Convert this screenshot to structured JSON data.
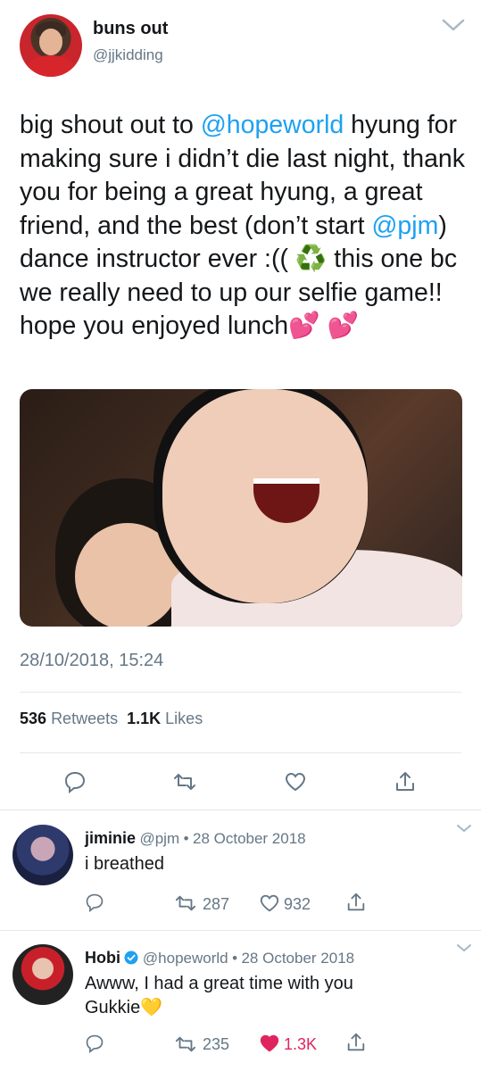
{
  "tweet": {
    "display_name": "buns out",
    "handle": "@jjkidding",
    "text_segments": [
      {
        "t": "big shout out to ",
        "link": false
      },
      {
        "t": "@hopeworld",
        "link": true
      },
      {
        "t": " hyung for making sure i didn’t die last night, thank you for being a great hyung, a great friend, and the best (don’t start ",
        "link": false
      },
      {
        "t": "@pjm",
        "link": true
      },
      {
        "t": ") dance instructor ever :(( ♻️ this one bc we really need to up our selfie game!! hope you enjoyed lunch💕 💕",
        "link": false
      }
    ],
    "timestamp": "28/10/2018, 15:24",
    "retweets_count": "536",
    "retweets_label": "Retweets",
    "likes_count": "1.1K",
    "likes_label": "Likes"
  },
  "replies": [
    {
      "name": "jiminie",
      "handle": "@pjm",
      "dot": "•",
      "date": "28 October 2018",
      "text": "i breathed",
      "retweets": "287",
      "likes": "932",
      "liked": false
    },
    {
      "name": "Hobi",
      "handle": "@hopeworld",
      "dot": "•",
      "date": "28 October 2018",
      "text": "Awww, I had a great time with you Gukkie💛",
      "retweets": "235",
      "likes": "1.3K",
      "liked": true
    }
  ],
  "colors": {
    "link": "#1da1f2",
    "muted": "#657786",
    "like_active": "#e0245e",
    "verified": "#1da1f2"
  },
  "icons": [
    "reply-icon",
    "retweet-icon",
    "like-icon",
    "share-icon",
    "chevron-down-icon",
    "verified-icon"
  ]
}
